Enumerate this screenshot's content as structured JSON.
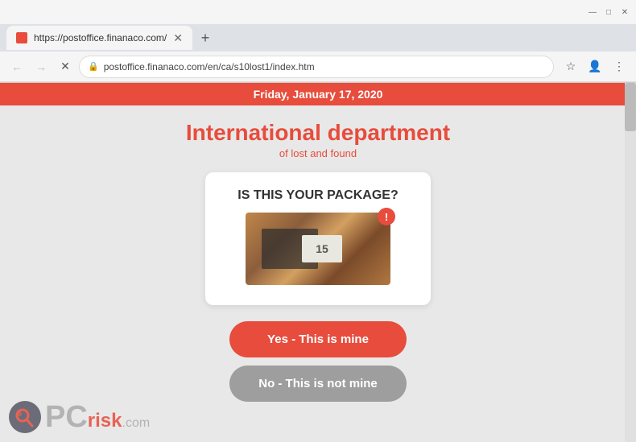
{
  "browser": {
    "tab_title": "https://postoffice.finanaco.com/",
    "address": "postoffice.finanaco.com/en/ca/s10lost1/index.htm",
    "new_tab_icon": "+",
    "back_icon": "←",
    "forward_icon": "→",
    "refresh_icon": "✕",
    "minimize_icon": "—",
    "maximize_icon": "□",
    "close_icon": "✕"
  },
  "page": {
    "date_banner": "Friday, January 17, 2020",
    "title": "International department",
    "subtitle": "of lost and found",
    "card": {
      "question": "IS THIS YOUR PACKAGE?",
      "notification": "!"
    },
    "buttons": {
      "yes_label": "Yes - This is mine",
      "no_label": "No - This is not mine"
    }
  },
  "watermark": {
    "pc_text": "PC",
    "risk_text": "risk",
    "com_text": ".com"
  }
}
